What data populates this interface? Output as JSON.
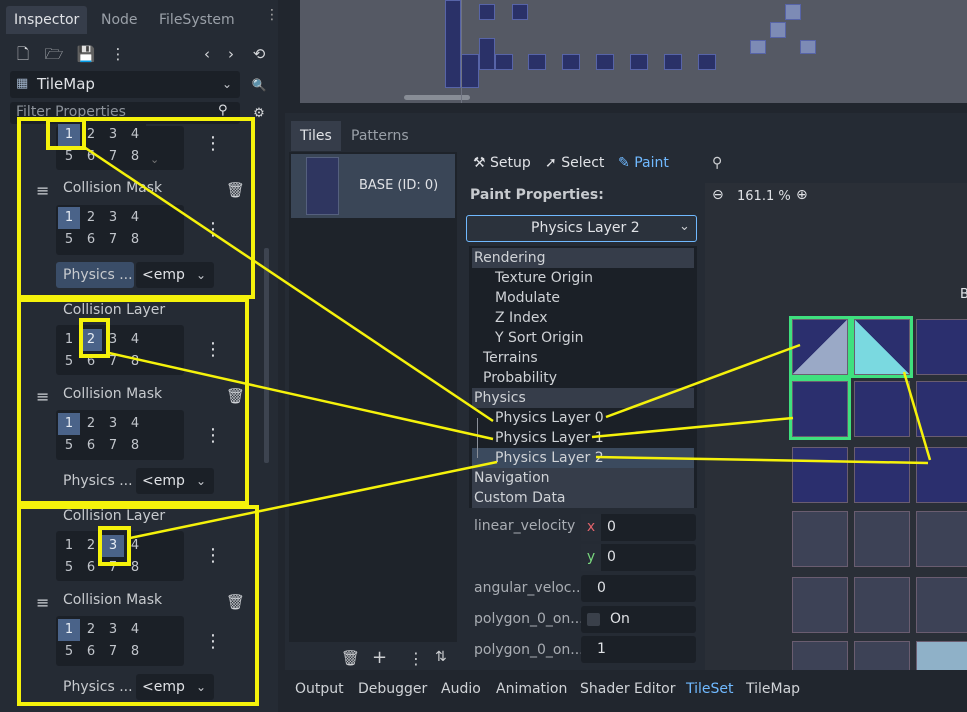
{
  "inspector": {
    "tabs": [
      "Inspector",
      "Node",
      "FileSystem"
    ],
    "node_type": "TileMap",
    "filter_placeholder": "Filter Properties",
    "layers": [
      {
        "layer_label": "",
        "layer_bits_on": [
          1
        ],
        "mask_label": "Collision Mask",
        "mask_bits_on": [
          1
        ],
        "phys_label": "Physics ...",
        "phys_value": "<emp"
      },
      {
        "layer_label": "Collision Layer",
        "layer_bits_on": [
          2
        ],
        "mask_label": "Collision Mask",
        "mask_bits_on": [
          1
        ],
        "phys_label": "Physics ...",
        "phys_value": "<emp"
      },
      {
        "layer_label": "Collision Layer",
        "layer_bits_on": [
          3
        ],
        "mask_label": "Collision Mask",
        "mask_bits_on": [
          1
        ],
        "phys_label": "Physics ...",
        "phys_value": "<emp"
      }
    ],
    "bit_rows": [
      [
        "1",
        "2",
        "3",
        "4"
      ],
      [
        "5",
        "6",
        "7",
        "8"
      ]
    ]
  },
  "tileset_panel": {
    "tabs": [
      "Tiles",
      "Patterns"
    ],
    "source_name": "BASE (ID: 0)",
    "modes": {
      "setup": "Setup",
      "select": "Select",
      "paint": "Paint"
    },
    "paint_properties_label": "Paint Properties:",
    "selected_property": "Physics Layer 2",
    "zoom": "161.1 %",
    "tree": [
      {
        "label": "Rendering",
        "indent": 0,
        "header": true
      },
      {
        "label": "Texture Origin",
        "indent": 2
      },
      {
        "label": "Modulate",
        "indent": 2
      },
      {
        "label": "Z Index",
        "indent": 2
      },
      {
        "label": "Y Sort Origin",
        "indent": 2
      },
      {
        "label": "Terrains",
        "indent": 1
      },
      {
        "label": "Probability",
        "indent": 1
      },
      {
        "label": "Physics",
        "indent": 0,
        "header": true
      },
      {
        "label": "Physics Layer 0",
        "indent": 2
      },
      {
        "label": "Physics Layer 1",
        "indent": 2
      },
      {
        "label": "Physics Layer 2",
        "indent": 2,
        "selected": true
      },
      {
        "label": "Navigation",
        "indent": 0,
        "header": true
      },
      {
        "label": "Custom Data",
        "indent": 0,
        "header": true
      }
    ],
    "props": {
      "linear_velocity": "linear_velocity",
      "lv_x_label": "x",
      "lv_x": "0",
      "lv_y_label": "y",
      "lv_y": "0",
      "angular_velocity": "angular_veloc...",
      "av_value": "0",
      "poly_on_label": "polygon_0_on...",
      "poly_on_value": "On",
      "poly_val_label": "polygon_0_on...",
      "poly_val_value": "1"
    },
    "atlas_edge_letter": "B"
  },
  "bottom_bar": [
    "Output",
    "Debugger",
    "Audio",
    "Animation",
    "Shader Editor",
    "TileSet",
    "TileMap"
  ],
  "colors": {
    "highlight": "#f5f20b",
    "accent": "#70b9ff",
    "selected_bit": "#4a6389",
    "collision_green": "#3fe07e"
  }
}
